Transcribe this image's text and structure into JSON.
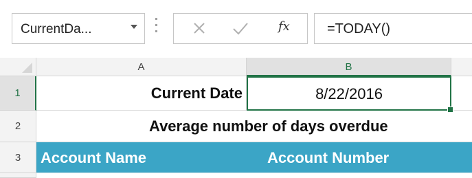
{
  "formula_bar": {
    "name_box": "CurrentDa...",
    "fx": "fx",
    "formula": "=TODAY()"
  },
  "columns": [
    "A",
    "B"
  ],
  "rows": [
    "1",
    "2",
    "3"
  ],
  "cells": {
    "A1": "Current Date",
    "B1": "8/22/2016",
    "row2": "Average number of days overdue",
    "A3": "Account Name",
    "B3": "Account Number"
  },
  "colors": {
    "selection": "#217346",
    "header_fill": "#3ba5c6"
  }
}
